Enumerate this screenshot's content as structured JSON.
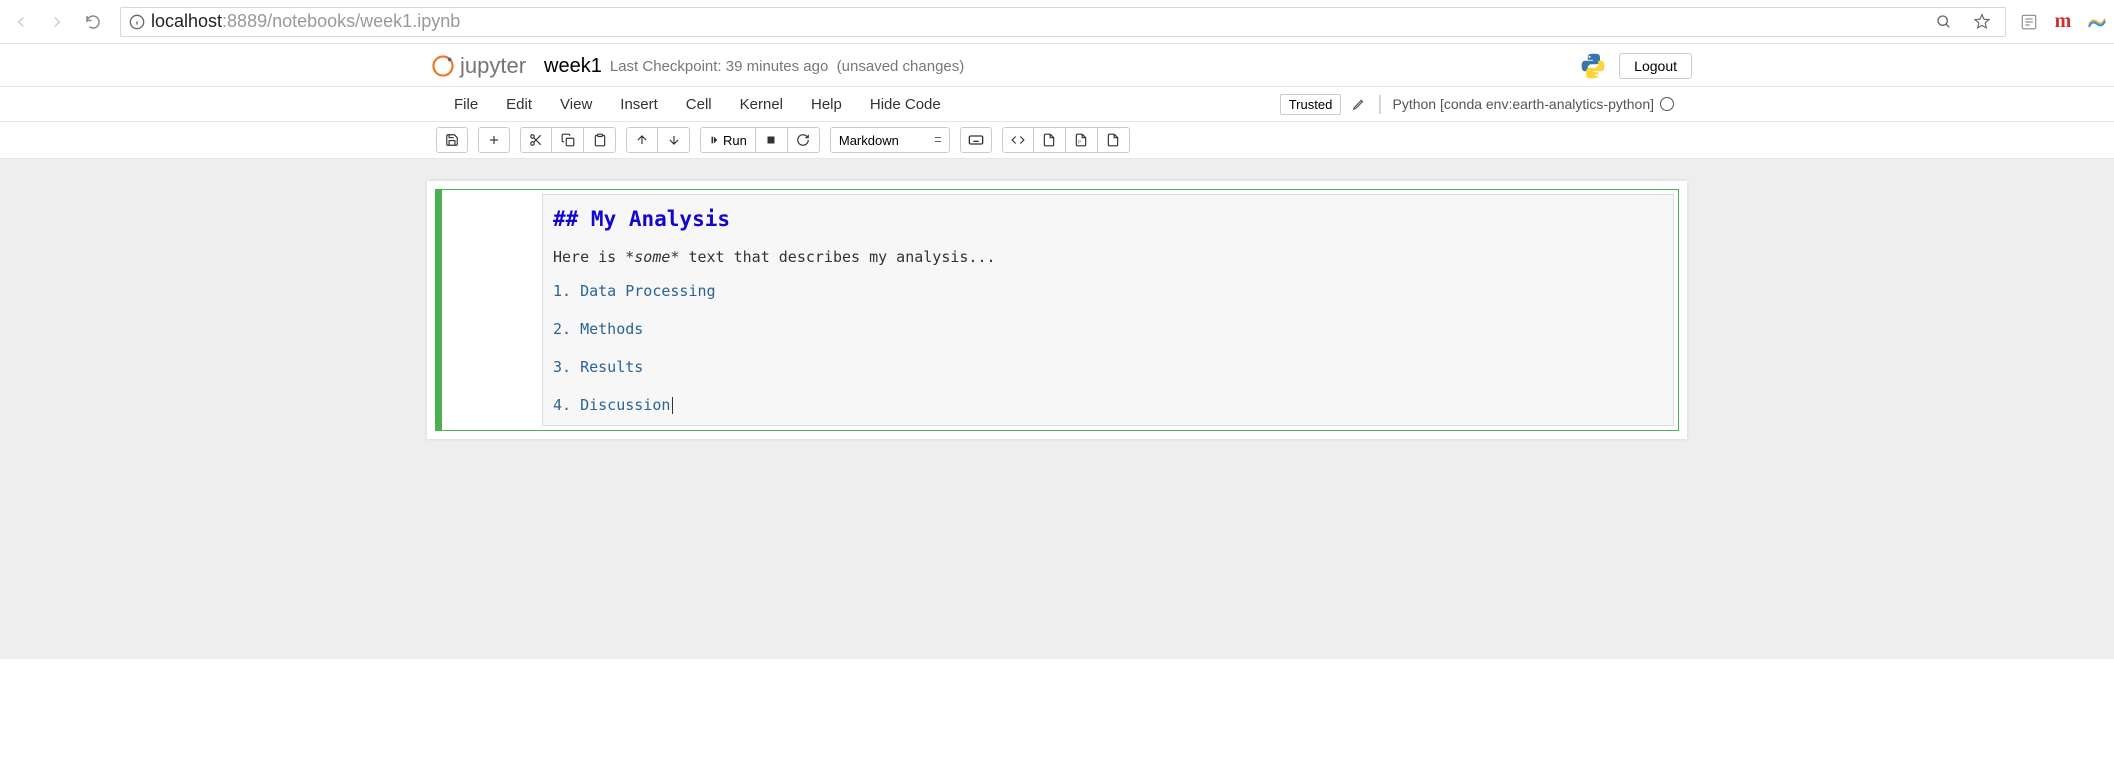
{
  "browser": {
    "url_host": "localhost",
    "url_port": ":8889",
    "url_path": "/notebooks/week1.ipynb"
  },
  "header": {
    "logo_text": "jupyter",
    "notebook_name": "week1",
    "checkpoint": "Last Checkpoint: 39 minutes ago",
    "unsaved": "(unsaved changes)",
    "logout": "Logout"
  },
  "menu": {
    "items": [
      "File",
      "Edit",
      "View",
      "Insert",
      "Cell",
      "Kernel",
      "Help",
      "Hide Code"
    ],
    "trusted": "Trusted",
    "kernel_name": "Python [conda env:earth-analytics-python]"
  },
  "toolbar": {
    "run_label": "Run",
    "cell_type": "Markdown"
  },
  "cell": {
    "heading": "## My Analysis",
    "body_pre": "Here is *",
    "body_italic": "some",
    "body_post": "* text that describes my analysis...",
    "list": [
      "1. Data Processing",
      "2. Methods",
      "3. Results",
      "4. Discussion"
    ]
  }
}
